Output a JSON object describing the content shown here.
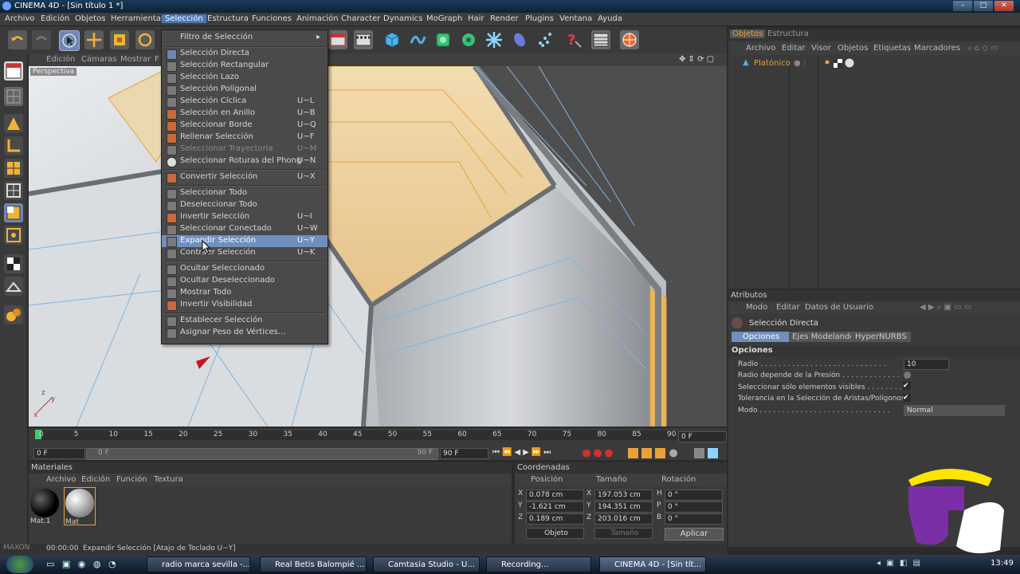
{
  "window": {
    "title": "CINEMA 4D - [Sin título 1 *]"
  },
  "menubar": [
    "Archivo",
    "Edición",
    "Objetos",
    "Herramientas",
    "Selección",
    "Estructura",
    "Funciones",
    "Animación",
    "Character",
    "Dynamics",
    "MoGraph",
    "Hair",
    "Render",
    "Plugins",
    "Ventana",
    "Ayuda"
  ],
  "menubar_active": "Selección",
  "viewport": {
    "menu": [
      "Edición",
      "Cámaras",
      "Mostrar",
      "F"
    ],
    "label": "Perspectiva"
  },
  "dropdown": {
    "items": [
      {
        "label": "Filtro de Selección",
        "shortcut": "",
        "submenu": true
      },
      {
        "label": "Selección Directa",
        "shortcut": ""
      },
      {
        "label": "Selección Rectangular",
        "shortcut": ""
      },
      {
        "label": "Selección Lazo",
        "shortcut": ""
      },
      {
        "label": "Selección Polígonal",
        "shortcut": ""
      },
      {
        "label": "Selección Cíclica",
        "shortcut": "U~L"
      },
      {
        "label": "Selección en Anillo",
        "shortcut": "U~B"
      },
      {
        "label": "Seleccionar Borde",
        "shortcut": "U~Q"
      },
      {
        "label": "Rellenar Selección",
        "shortcut": "U~F"
      },
      {
        "label": "Seleccionar Trayectoria",
        "shortcut": "U~M",
        "disabled": true
      },
      {
        "label": "Seleccionar Roturas del Phong",
        "shortcut": "U~N"
      },
      {
        "label": "Convertir Selección",
        "shortcut": "U~X"
      },
      {
        "label": "Seleccionar Todo",
        "shortcut": ""
      },
      {
        "label": "Deseleccionar Todo",
        "shortcut": ""
      },
      {
        "label": "Invertir Selección",
        "shortcut": "U~I"
      },
      {
        "label": "Seleccionar Conectado",
        "shortcut": "U~W"
      },
      {
        "label": "Expandir Selección",
        "shortcut": "U~Y",
        "highlighted": true
      },
      {
        "label": "Contraer Selección",
        "shortcut": "U~K"
      },
      {
        "label": "Ocultar Seleccionado",
        "shortcut": ""
      },
      {
        "label": "Ocultar Deseleccionado",
        "shortcut": ""
      },
      {
        "label": "Mostrar Todo",
        "shortcut": ""
      },
      {
        "label": "Invertir Visibilidad",
        "shortcut": ""
      },
      {
        "label": "Establecer Selección",
        "shortcut": ""
      },
      {
        "label": "Asignar Peso de Vértices...",
        "shortcut": ""
      }
    ]
  },
  "timeline": {
    "ticks": [
      "0",
      "5",
      "10",
      "15",
      "20",
      "25",
      "30",
      "35",
      "40",
      "45",
      "50",
      "55",
      "60",
      "65",
      "70",
      "75",
      "80",
      "85",
      "90"
    ],
    "current_frame": "0 F",
    "start": "0 F",
    "range_start": "0 F",
    "range_end": "90 F",
    "end": "90 F"
  },
  "materials": {
    "title": "Materiales",
    "menu": [
      "Archivo",
      "Edición",
      "Función",
      "Textura"
    ],
    "items": [
      {
        "name": "Mat.1",
        "color": "#111111"
      },
      {
        "name": "Mat",
        "color": "#d8d8d8"
      }
    ]
  },
  "coords": {
    "title": "Coordenadas",
    "headers": [
      "Posición",
      "Tamaño",
      "Rotación"
    ],
    "rows": [
      {
        "axis": "X",
        "pos": "0.078 cm",
        "size_axis": "X",
        "size": "197.053 cm",
        "rot_axis": "H",
        "rot": "0 °"
      },
      {
        "axis": "Y",
        "pos": "-1.621 cm",
        "size_axis": "Y",
        "size": "194.351 cm",
        "rot_axis": "P",
        "rot": "0 °"
      },
      {
        "axis": "Z",
        "pos": "0.189 cm",
        "size_axis": "Z",
        "size": "203.016 cm",
        "rot_axis": "B",
        "rot": "0 °"
      }
    ],
    "mode": "Objeto",
    "mode2": "Tamaño",
    "apply": "Aplicar"
  },
  "objects": {
    "tabs": [
      "Objetos",
      "Estructura"
    ],
    "menu": [
      "Archivo",
      "Editar",
      "Visor",
      "Objetos",
      "Etiquetas",
      "Marcadores"
    ],
    "tree": [
      {
        "name": "Platónico"
      }
    ]
  },
  "attributes": {
    "title": "Atributos",
    "menu": [
      "Modo",
      "Editar",
      "Datos de Usuario"
    ],
    "tool": "Selección Directa",
    "tabs": [
      "Opciones",
      "Ejes Modelando",
      "HyperNURBS"
    ],
    "section": "Opciones",
    "fields": [
      {
        "label": "Radio . . . . . . . . . . . . . . . . . . . . . . . . . . . .",
        "value": "10"
      },
      {
        "label": "Radio depende de la Presión . . . . . . . . . . . . .",
        "value": ""
      },
      {
        "label": "Seleccionar sólo elementos visibles . . . . . . . . .",
        "value": "✔"
      },
      {
        "label": "Tolerancia en la Selección de Aristas/Polígonos",
        "value": "✔"
      },
      {
        "label": "Modo . . . . . . . . . . . . . . . . . . . . . . . . . . . . .",
        "value": "Normal"
      }
    ]
  },
  "status": {
    "time": "00:00:00",
    "text": "Expandir Selección [Atajo de Teclado U~Y]"
  },
  "taskbar": {
    "tasks": [
      {
        "label": "radio marca sevilla -...",
        "color": "#c33"
      },
      {
        "label": "Real Betis Balompié ...",
        "color": "#e7a21c"
      },
      {
        "label": "Camtasia Studio - U...",
        "color": "#4b9b4b"
      },
      {
        "label": "Recording...",
        "color": "#c33"
      },
      {
        "label": "CINEMA 4D - [Sin tít...",
        "color": "#4a7ac0"
      }
    ],
    "clock": "13:49"
  }
}
